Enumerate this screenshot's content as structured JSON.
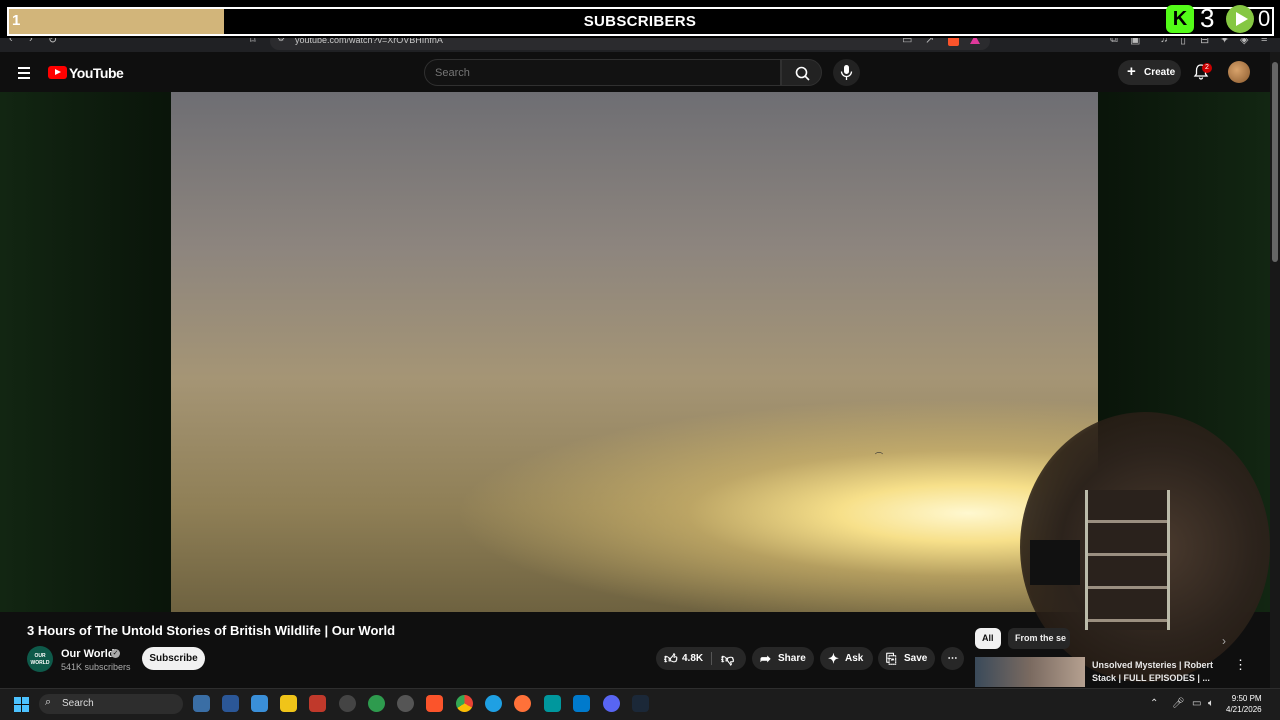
{
  "overlay": {
    "goal_number": "1",
    "goal_label": "SUBSCRIBERS",
    "goal_progress_fraction": 0.17,
    "kick_count": "3",
    "rumble_count": "0",
    "kick_icon_glyph": "K",
    "colors": {
      "progress": "#d2b57a",
      "kick": "#53fc18",
      "rumble": "#85c742"
    }
  },
  "browser": {
    "url": "youtube.com/watch?v=XrOVBHInfhA"
  },
  "header": {
    "logo_text": "YouTube",
    "search_placeholder": "Search",
    "create_label": "Create",
    "notification_count": "2"
  },
  "video": {
    "title": "3 Hours of The Untold Stories of British Wildlife | Our World",
    "channel_avatar_text": "OUR WORLD",
    "channel_name": "Our World",
    "subscribers": "541K subscribers",
    "subscribe_label": "Subscribe",
    "likes": "4.8K",
    "share_label": "Share",
    "ask_label": "Ask",
    "save_label": "Save"
  },
  "sidebar": {
    "chips": [
      "All",
      "From the se"
    ],
    "related": {
      "title": "Unsolved Mysteries | Robert Stack | FULL EPISODES | ..."
    }
  },
  "taskbar": {
    "search_label": "Search",
    "time": "9:50 PM",
    "date": "4/21/2026"
  }
}
